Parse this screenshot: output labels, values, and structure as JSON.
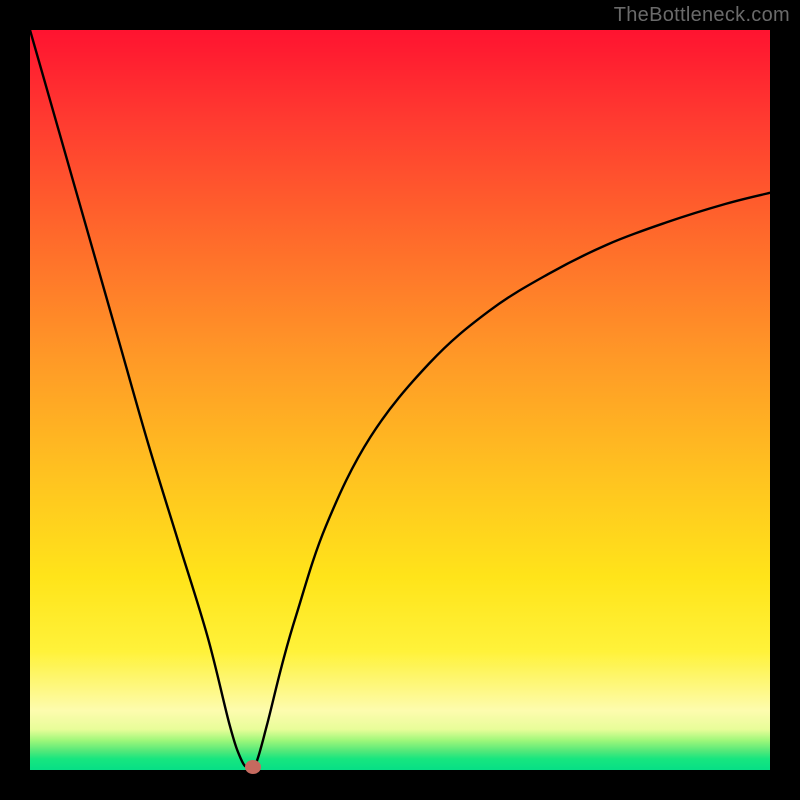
{
  "watermark": "TheBottleneck.com",
  "chart_data": {
    "type": "line",
    "title": "",
    "xlabel": "",
    "ylabel": "",
    "xlim": [
      0,
      100
    ],
    "ylim": [
      0,
      100
    ],
    "grid": false,
    "legend": false,
    "background_gradient": {
      "top": "#ff1330",
      "mid_upper": "#ff9827",
      "mid_lower": "#ffe41a",
      "near_bottom": "#fdfcae",
      "bottom": "#07df86"
    },
    "note": "Single black curve: steep descending left branch into a narrow minimum near x≈30, then rising concave right branch approaching ~78% height at x=100.",
    "series": [
      {
        "name": "curve",
        "x": [
          0,
          4,
          8,
          12,
          16,
          20,
          24,
          27,
          28.5,
          29.5,
          30.5,
          32,
          34,
          36,
          40,
          46,
          54,
          62,
          70,
          78,
          86,
          94,
          100
        ],
        "y": [
          100,
          86,
          72,
          58,
          44,
          31,
          18,
          6,
          1.5,
          0.3,
          0.8,
          6,
          14,
          21,
          33,
          45,
          55,
          62,
          67,
          71,
          74,
          76.5,
          78
        ]
      }
    ],
    "marker": {
      "x": 30.2,
      "y": 0.4,
      "color": "#c66a5f"
    }
  }
}
